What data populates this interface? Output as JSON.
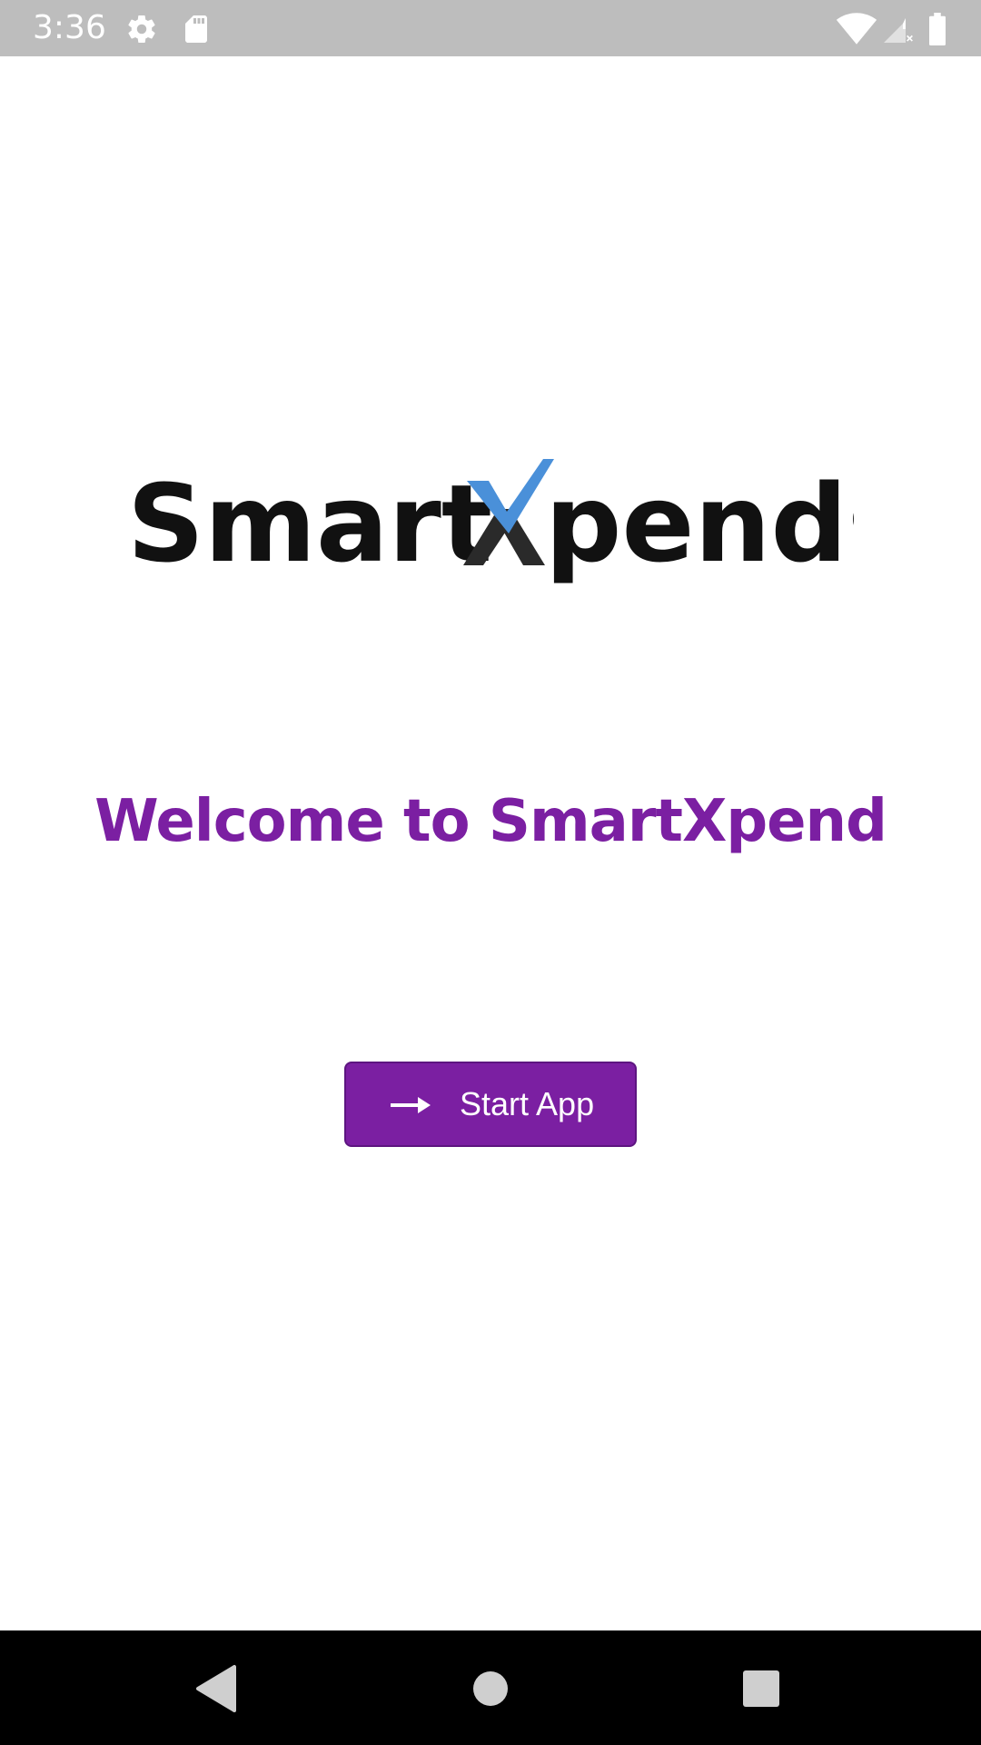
{
  "status_bar": {
    "time": "3:36",
    "icons": [
      "gear-icon",
      "sd-card-icon",
      "wifi-icon",
      "signal-icon",
      "battery-icon"
    ]
  },
  "logo": {
    "text_before": "Smart",
    "text_x": "X",
    "text_after": "pends",
    "check_color": "#4a90d9",
    "text_color": "#111111"
  },
  "welcome": {
    "title": "Welcome to SmartXpend"
  },
  "start_button": {
    "label": "Start App",
    "icon": "arrow-right-icon",
    "color": "#7b1fa2"
  },
  "nav_bar": {
    "buttons": [
      "back",
      "home",
      "recents"
    ]
  }
}
